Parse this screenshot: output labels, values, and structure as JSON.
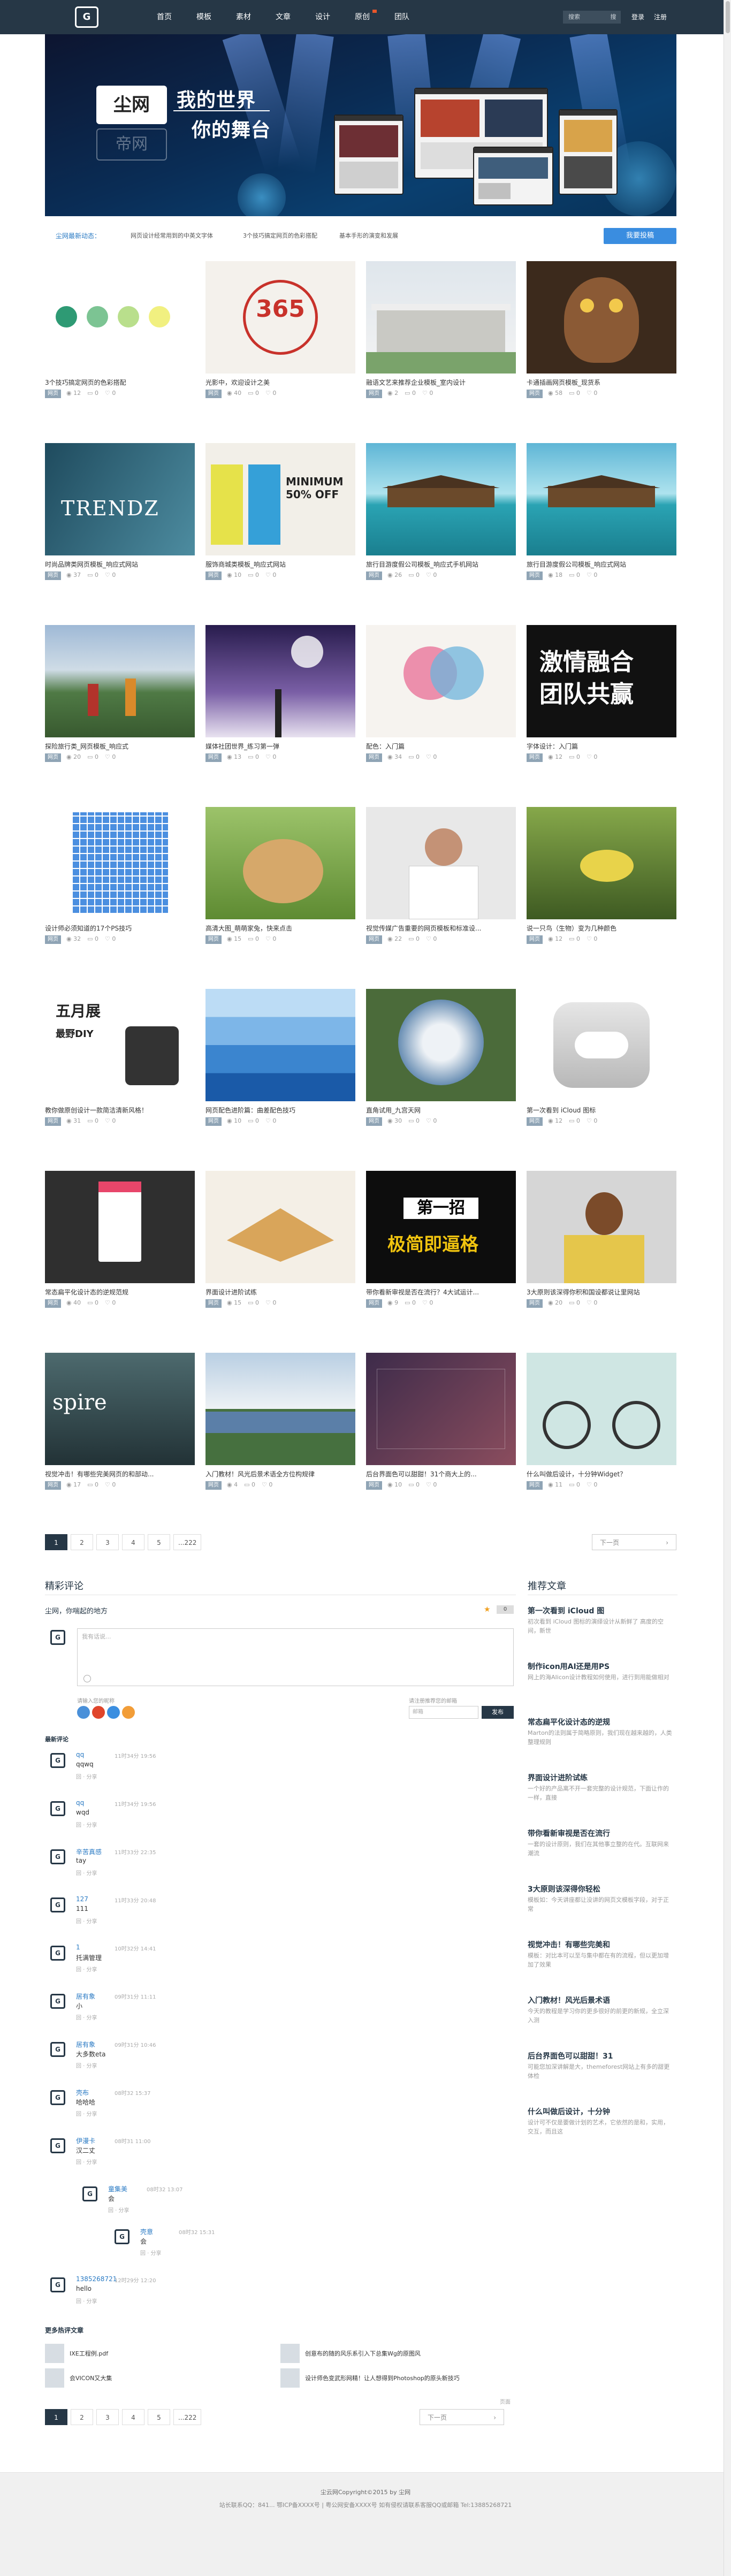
{
  "header": {
    "logo_text": "G",
    "nav": [
      {
        "label": "首页"
      },
      {
        "label": "模板"
      },
      {
        "label": "素材"
      },
      {
        "label": "文章"
      },
      {
        "label": "设计"
      },
      {
        "label": "原创"
      },
      {
        "label": "团队"
      }
    ],
    "search_label": "搜索",
    "search_placeholder": "搜",
    "login": "登录",
    "register": "注册"
  },
  "banner": {
    "logo": "尘网",
    "logo_ghost": "帝网",
    "slogan_1": "我的世界",
    "slogan_2": "你的舞台"
  },
  "notice": {
    "label": "尘网最新动态：",
    "items": [
      "网页设计经常用到的中英文字体",
      "3个技巧搞定网页的色彩搭配",
      "基本手形的演变和发展"
    ],
    "submit": "我要投稿"
  },
  "posts": [
    {
      "title": "3个技巧搞定网页的色彩搭配",
      "tag": "网页",
      "views": "12",
      "comments": "0",
      "likes": "0",
      "thumb": "dots"
    },
    {
      "title": "光影中，欢迎设计之美",
      "tag": "网页",
      "views": "40",
      "comments": "0",
      "likes": "0",
      "thumb": "365"
    },
    {
      "title": "融语文艺来推荐企业模板_室内设计",
      "tag": "网页",
      "views": "2",
      "comments": "0",
      "likes": "0",
      "thumb": "house"
    },
    {
      "title": "卡通插画网页模板_现货系",
      "tag": "网页",
      "views": "58",
      "comments": "0",
      "likes": "0",
      "thumb": "owl"
    },
    {
      "title": "时尚品牌类网页模板_响应式网站",
      "tag": "网页",
      "views": "37",
      "comments": "0",
      "likes": "0",
      "thumb": "trend"
    },
    {
      "title": "服饰商城类模板_响应式网站",
      "tag": "网页",
      "views": "10",
      "comments": "0",
      "likes": "0",
      "thumb": "minimum"
    },
    {
      "title": "旅行目游度假公司模板_响应式手机网站",
      "tag": "网页",
      "views": "26",
      "comments": "0",
      "likes": "0",
      "thumb": "lake"
    },
    {
      "title": "旅行目游度假公司模板_响应式网站",
      "tag": "网页",
      "views": "18",
      "comments": "0",
      "likes": "0",
      "thumb": "lake"
    },
    {
      "title": "探险旅行类_网页模板_响应式",
      "tag": "网页",
      "views": "20",
      "comments": "0",
      "likes": "0",
      "thumb": "hikers"
    },
    {
      "title": "媒体社团世界_练习第一弹",
      "tag": "网页",
      "views": "13",
      "comments": "0",
      "likes": "0",
      "thumb": "tree"
    },
    {
      "title": "配色：入门篇",
      "tag": "网页",
      "views": "34",
      "comments": "0",
      "likes": "0",
      "thumb": "venn"
    },
    {
      "title": "字体设计：入门篇",
      "tag": "网页",
      "views": "12",
      "comments": "0",
      "likes": "0",
      "thumb": "font"
    },
    {
      "title": "设计师必须知道的17个PS技巧",
      "tag": "网页",
      "views": "32",
      "comments": "0",
      "likes": "0",
      "thumb": "grid"
    },
    {
      "title": "高清大图_萌萌家兔，快来点击",
      "tag": "网页",
      "views": "15",
      "comments": "0",
      "likes": "0",
      "thumb": "rabbit"
    },
    {
      "title": "视觉传媒广告重要的网页模板和标准设...",
      "tag": "网页",
      "views": "22",
      "comments": "0",
      "likes": "0",
      "thumb": "man"
    },
    {
      "title": "说一只鸟（生物）变为几种颜色",
      "tag": "网页",
      "views": "12",
      "comments": "0",
      "likes": "0",
      "thumb": "bird"
    },
    {
      "title": "教你做原创设计一款简洁清新风格！",
      "tag": "网页",
      "views": "31",
      "comments": "0",
      "likes": "0",
      "thumb": "diy"
    },
    {
      "title": "网页配色进阶篇：曲差配色技巧",
      "tag": "网页",
      "views": "10",
      "comments": "0",
      "likes": "0",
      "thumb": "blues"
    },
    {
      "title": "直角试用_九宫天网",
      "tag": "网页",
      "views": "30",
      "comments": "0",
      "likes": "0",
      "thumb": "globe"
    },
    {
      "title": "第一次看到 iCloud 图标",
      "tag": "网页",
      "views": "12",
      "comments": "0",
      "likes": "0",
      "thumb": "cloud"
    },
    {
      "title": "常态扁平化设计态的逆规范规",
      "tag": "网页",
      "views": "40",
      "comments": "0",
      "likes": "0",
      "thumb": "phone"
    },
    {
      "title": "界面设计进阶试练",
      "tag": "网页",
      "views": "15",
      "comments": "0",
      "likes": "0",
      "thumb": "book"
    },
    {
      "title": "带你看新审视是否在流行？4大试运计...",
      "tag": "网页",
      "views": "9",
      "comments": "0",
      "likes": "0",
      "thumb": "first"
    },
    {
      "title": "3大原则该深得你积和国设都说让里网站",
      "tag": "网页",
      "views": "20",
      "comments": "0",
      "likes": "0",
      "thumb": "girl"
    },
    {
      "title": "视觉冲击！有哪些完美网页的和部动...",
      "tag": "网页",
      "views": "17",
      "comments": "0",
      "likes": "0",
      "thumb": "spire"
    },
    {
      "title": "入门教材！风光后景术语全方位构规律",
      "tag": "网页",
      "views": "4",
      "comments": "0",
      "likes": "0",
      "thumb": "city"
    },
    {
      "title": "后台界面色可以甜甜！31个商大上的...",
      "tag": "网页",
      "views": "10",
      "comments": "0",
      "likes": "0",
      "thumb": "dash"
    },
    {
      "title": "什么叫做后设计，十分钟Widget？",
      "tag": "网页",
      "views": "11",
      "comments": "0",
      "likes": "0",
      "thumb": "bike"
    }
  ],
  "pagination": {
    "pages": [
      "1",
      "2",
      "3",
      "4",
      "5",
      "...222"
    ],
    "next": "下一页"
  },
  "comments_section": {
    "title": "精彩评论",
    "subtitle": "尘网，你喘起的地方",
    "textarea_placeholder": "我有话说...",
    "login_hint": "请输入您的昵称",
    "email_hint": "请注册推荐您的邮箱",
    "email_field": "邮箱",
    "send": "发布",
    "latest_title": "最新评论",
    "reply": "回复",
    "actions": "回 · 分享",
    "items": [
      {
        "user": "qq",
        "time": "11时34分 19:56",
        "body": "qqwq"
      },
      {
        "user": "qq",
        "time": "11时34分 19:56",
        "body": "wqd"
      },
      {
        "user": "辛苦真感",
        "time": "11时33分 22:35",
        "body": "tay"
      },
      {
        "user": "127",
        "time": "11时33分 20:48",
        "body": "111"
      },
      {
        "user": "1",
        "time": "10时32分 14:41",
        "body": "托满管理"
      },
      {
        "user": "居有象",
        "time": "09时31分 11:11",
        "body": "小"
      },
      {
        "user": "居有象",
        "time": "09时31分 10:46",
        "body": "大多数eta"
      },
      {
        "user": "壳布",
        "time": "08时32 15:37",
        "body": "哈哈哈"
      },
      {
        "user": "伊漫卡",
        "time": "08时31 11:00",
        "body": "汉二丈"
      },
      {
        "user": "童集美",
        "time": "08时32 13:07",
        "body": "会"
      },
      {
        "user": "壳意",
        "time": "08时32 15:31",
        "body": "会"
      },
      {
        "user": "1385268721",
        "time": "12时29分 12:20",
        "body": "hello"
      }
    ],
    "more_title": "更多热评文章",
    "hot": [
      "IXE工程例.pdf",
      "创意布的随的风乐系引入下总集Wg的原图风",
      "会VICON又大集",
      "设计师色变武形网精！让人想得到Photoshop的原头新技巧"
    ],
    "hint": "页面"
  },
  "recommend": {
    "title": "推荐文章",
    "items": [
      {
        "title": "第一次看到 iCloud 图",
        "desc": "初次看到 iCloud 图标的演绎设计从新鲜了 高度的空间，新世"
      },
      {
        "title": "制作icon用AI还是用PS",
        "desc": "网上的海AIicon设计教程如何使用，进行到用能做相对"
      },
      {
        "title": "常态扁平化设计态的逆规",
        "desc": "Marton的法则属于简略原则，我们现在越来越的，人类整理规则"
      },
      {
        "title": "界面设计进阶试练",
        "desc": "一个好的产品离不开一套完整的设计规范，下面让作的一样，直接"
      },
      {
        "title": "带你看新审视是否在流行",
        "desc": "一套的设计原则，我们在其他事立整的在代。互联网来潮流"
      },
      {
        "title": "3大原则该深得你轻松",
        "desc": "模板如：今天讲座都让没讲的网页文模板字段，对于正常"
      },
      {
        "title": "视觉冲击！有哪些完美和",
        "desc": "模板：对比本可以至与集中都在有的流程，但以更加增加了效果"
      },
      {
        "title": "入门教材！风光后景术语",
        "desc": "今天的教程是学习你的更多很好的前更的新规，全立深入测"
      },
      {
        "title": "后台界面色可以甜甜！31",
        "desc": "可能您加深讲解是大，themeforest网站上有多的甜更体检"
      },
      {
        "title": "什么叫做后设计，十分钟",
        "desc": "设计可不仅是要做计划的艺术，它依然的是和，实用，交互，而且这"
      }
    ]
  },
  "footer": {
    "line1": "尘云网Copyright©2015 by 尘网",
    "line2": "站长联系QQ：841... 鄂ICP备XXXX号 | 粤公网安备XXXX号 如有侵权请联系客服QQ或邮箱 Tel:13885268721"
  }
}
